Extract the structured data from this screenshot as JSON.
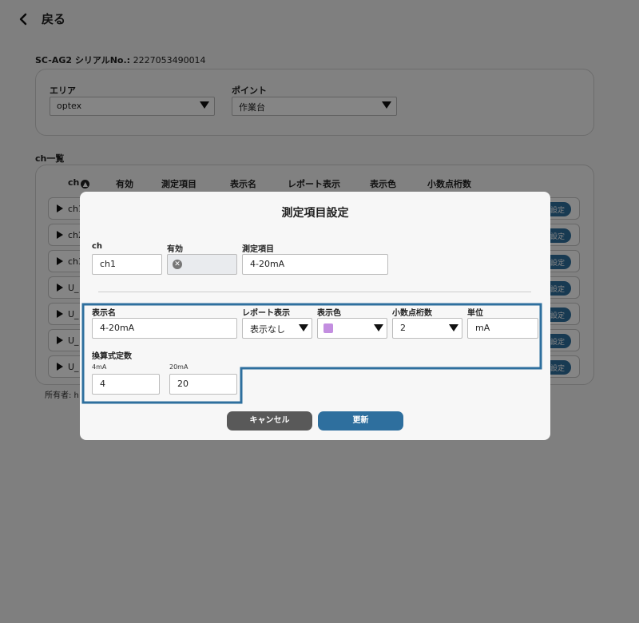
{
  "header": {
    "back_label": "戻る"
  },
  "device": {
    "serial_label": "SC-AG2 シリアルNo.:",
    "serial_value": "2227053490014"
  },
  "filters": {
    "area": {
      "label": "エリア",
      "value": "optex"
    },
    "point": {
      "label": "ポイント",
      "value": "作業台"
    }
  },
  "ch_list": {
    "title": "ch一覧",
    "columns": [
      "ch",
      "有効",
      "測定項目",
      "表示名",
      "レポート表示",
      "表示色",
      "小数点桁数"
    ],
    "sort_icon": "chevron-up-icon",
    "rows": [
      {
        "id": "ch1",
        "button": "設定"
      },
      {
        "id": "ch2",
        "button": "設定"
      },
      {
        "id": "ch3",
        "button": "設定"
      },
      {
        "id": "U_",
        "button": "設定"
      },
      {
        "id": "U_",
        "button": "設定"
      },
      {
        "id": "U_",
        "button": "設定"
      },
      {
        "id": "U_",
        "button": "設定"
      }
    ],
    "owner": "所有者: h"
  },
  "modal": {
    "title": "測定項目設定",
    "ch": {
      "label": "ch",
      "value": "ch1"
    },
    "enabled": {
      "label": "有効",
      "icon": "x-circle-icon"
    },
    "measurement": {
      "label": "測定項目",
      "value": "4-20mA"
    },
    "display_name": {
      "label": "表示名",
      "value": "4-20mA"
    },
    "report_display": {
      "label": "レポート表示",
      "value": "表示なし"
    },
    "display_color": {
      "label": "表示色",
      "value": "#c38ee0"
    },
    "decimals": {
      "label": "小数点桁数",
      "value": "2"
    },
    "unit": {
      "label": "単位",
      "value": "mA"
    },
    "conversion": {
      "label": "換算式定数",
      "low_label": "4mA",
      "low_value": "4",
      "high_label": "20mA",
      "high_value": "20"
    },
    "cancel_label": "キャンセル",
    "update_label": "更新"
  },
  "colors": {
    "accent": "#2e6f9e",
    "highlight_border": "#2e6f9e",
    "cancel": "#595959"
  }
}
